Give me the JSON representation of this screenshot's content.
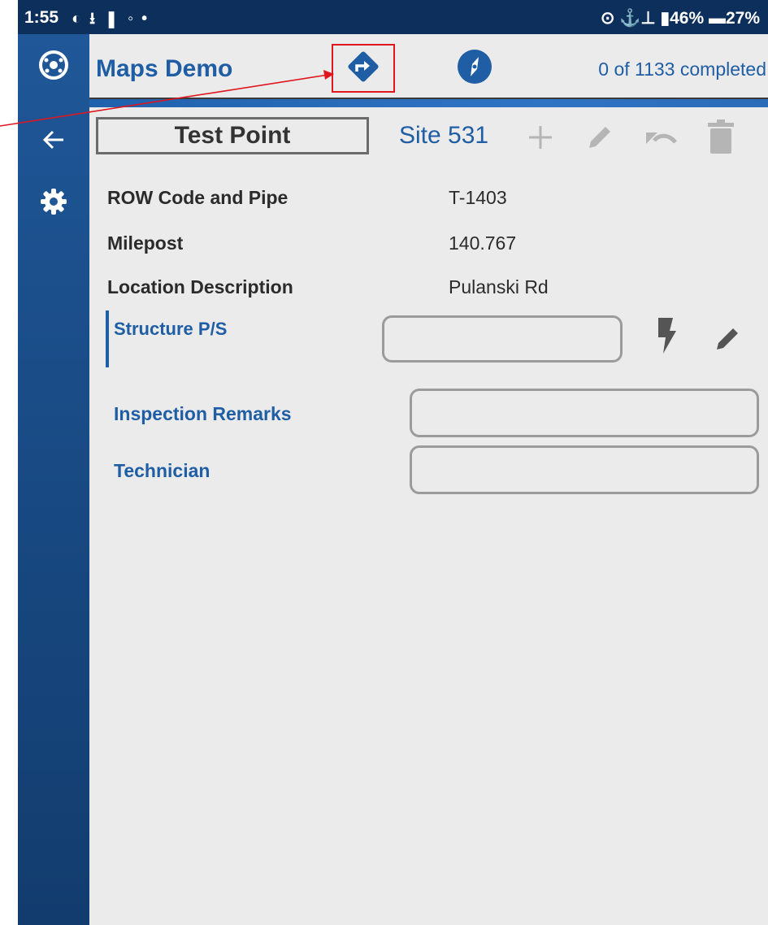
{
  "status_bar": {
    "time": "1:55",
    "right_text": "⊙  ⚓⊥  ▮46% ▬27%"
  },
  "header": {
    "title": "Maps Demo",
    "completed": "0 of 1133 completed"
  },
  "record": {
    "type_button": "Test Point",
    "site_label": "Site 531"
  },
  "fields": [
    {
      "label": "ROW Code and Pipe",
      "value": "T-1403"
    },
    {
      "label": "Milepost",
      "value": "140.767"
    },
    {
      "label": "Location Description",
      "value": "Pulanski Rd"
    }
  ],
  "structure": {
    "label": "Structure P/S",
    "value": ""
  },
  "inspection": {
    "label": "Inspection Remarks",
    "value": ""
  },
  "technician": {
    "label": "Technician",
    "value": ""
  },
  "colors": {
    "brand_blue": "#1f5ea4",
    "annotation_red": "#e0161f"
  }
}
